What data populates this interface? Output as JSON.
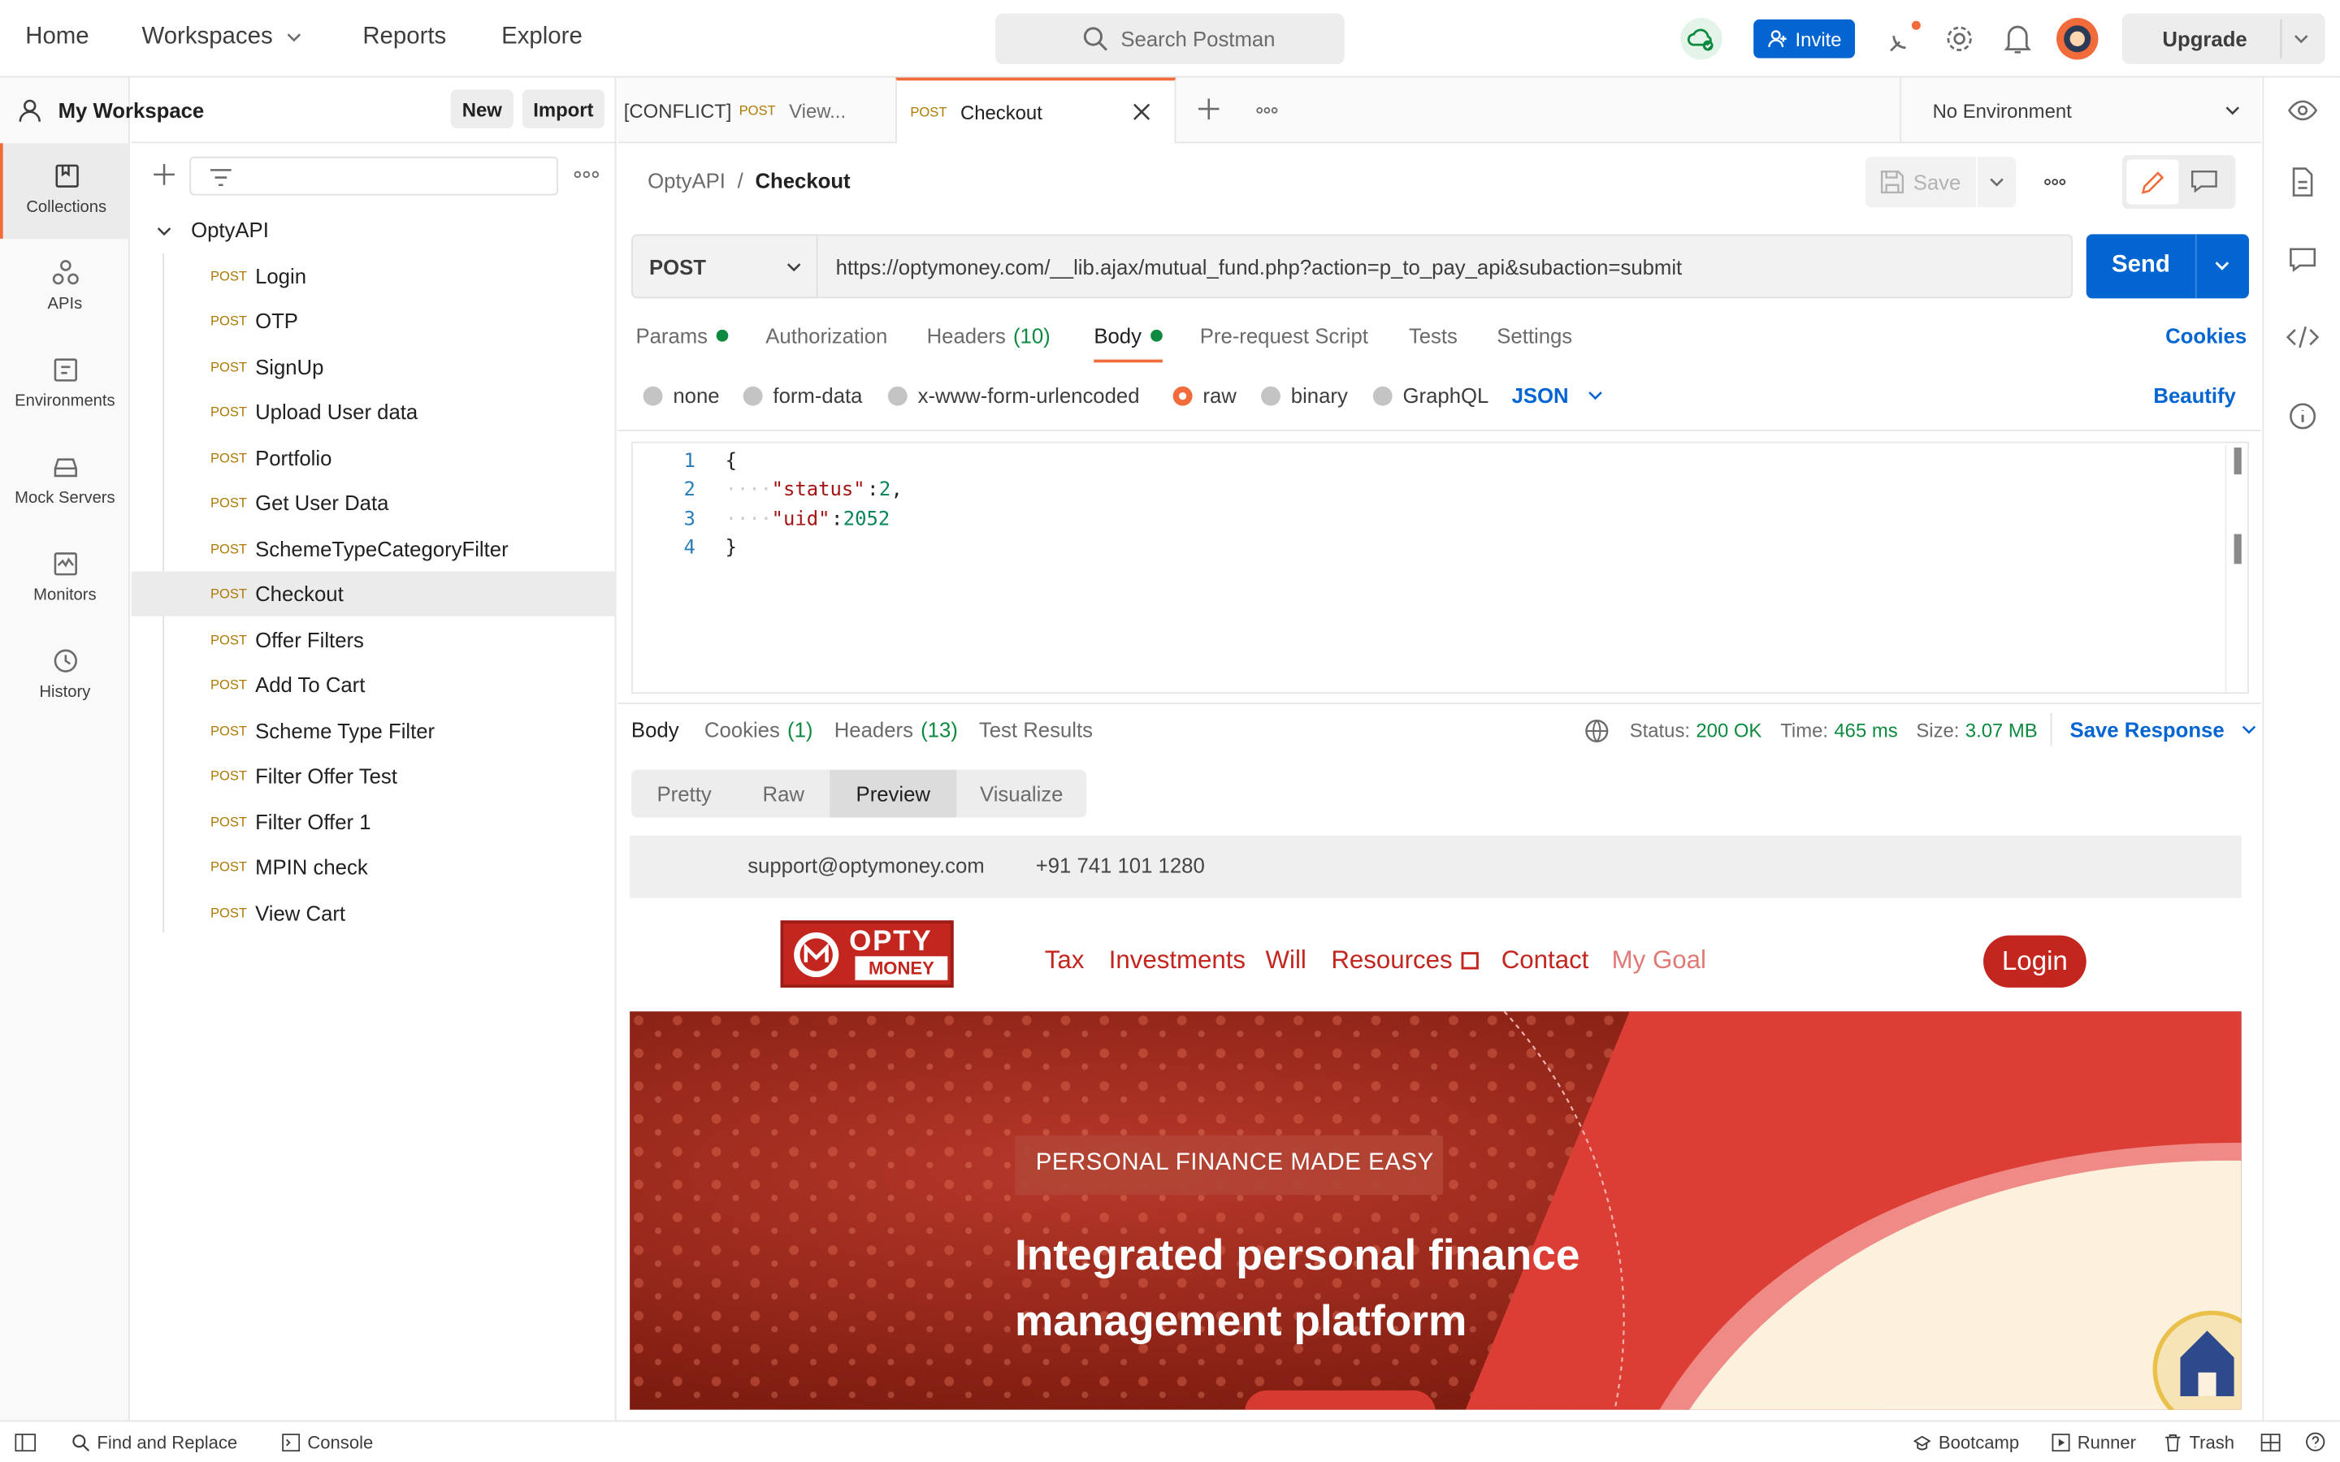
{
  "topbar": {
    "nav": [
      "Home",
      "Workspaces",
      "Reports",
      "Explore"
    ],
    "search_placeholder": "Search Postman",
    "invite_label": "Invite",
    "upgrade_label": "Upgrade"
  },
  "rail": {
    "items": [
      {
        "label": "Collections",
        "icon": "collections-icon"
      },
      {
        "label": "APIs",
        "icon": "apis-icon"
      },
      {
        "label": "Environments",
        "icon": "environments-icon"
      },
      {
        "label": "Mock Servers",
        "icon": "mock-servers-icon"
      },
      {
        "label": "Monitors",
        "icon": "monitors-icon"
      },
      {
        "label": "History",
        "icon": "history-icon"
      }
    ]
  },
  "sidebar": {
    "workspace_name": "My Workspace",
    "new_label": "New",
    "import_label": "Import",
    "collection_name": "OptyAPI",
    "requests": [
      {
        "method": "POST",
        "name": "Login"
      },
      {
        "method": "POST",
        "name": "OTP"
      },
      {
        "method": "POST",
        "name": "SignUp"
      },
      {
        "method": "POST",
        "name": "Upload User data"
      },
      {
        "method": "POST",
        "name": "Portfolio"
      },
      {
        "method": "POST",
        "name": "Get User Data"
      },
      {
        "method": "POST",
        "name": "SchemeTypeCategoryFilter"
      },
      {
        "method": "POST",
        "name": "Checkout"
      },
      {
        "method": "POST",
        "name": "Offer Filters"
      },
      {
        "method": "POST",
        "name": "Add To Cart"
      },
      {
        "method": "POST",
        "name": "Scheme Type Filter"
      },
      {
        "method": "POST",
        "name": "Filter Offer Test"
      },
      {
        "method": "POST",
        "name": "Filter Offer 1"
      },
      {
        "method": "POST",
        "name": "MPIN check"
      },
      {
        "method": "POST",
        "name": "View Cart"
      }
    ]
  },
  "tabs": {
    "tab1": {
      "prefix": "[CONFLICT]",
      "method": "POST",
      "name": "View..."
    },
    "tab2": {
      "method": "POST",
      "name": "Checkout"
    },
    "environment": "No Environment"
  },
  "request": {
    "breadcrumb_parent": "OptyAPI",
    "breadcrumb_sep": "/",
    "breadcrumb_current": "Checkout",
    "save_label": "Save",
    "method": "POST",
    "url": "https://optymoney.com/__lib.ajax/mutual_fund.php?action=p_to_pay_api&subaction=submit",
    "send_label": "Send",
    "tabs": {
      "params": "Params",
      "authorization": "Authorization",
      "headers": "Headers",
      "headers_count": "(10)",
      "body": "Body",
      "prerequest": "Pre-request Script",
      "tests": "Tests",
      "settings": "Settings",
      "cookies": "Cookies"
    },
    "body_types": [
      "none",
      "form-data",
      "x-www-form-urlencoded",
      "raw",
      "binary",
      "GraphQL"
    ],
    "body_format": "JSON",
    "beautify_label": "Beautify",
    "code": {
      "line_numbers": [
        "1",
        "2",
        "3",
        "4"
      ],
      "l1": "{",
      "l2_key": "\"status\"",
      "l2_val": "2",
      "l3_key": "\"uid\"",
      "l3_val": "2052",
      "l4": "}"
    }
  },
  "response": {
    "tabs": {
      "body": "Body",
      "cookies": "Cookies",
      "cookies_count": "(1)",
      "headers": "Headers",
      "headers_count": "(13)",
      "test_results": "Test Results"
    },
    "status_label": "Status:",
    "status_value": "200 OK",
    "time_label": "Time:",
    "time_value": "465 ms",
    "size_label": "Size:",
    "size_value": "3.07 MB",
    "save_response_label": "Save Response",
    "view_tabs": [
      "Pretty",
      "Raw",
      "Preview",
      "Visualize"
    ]
  },
  "preview": {
    "email": "support@optymoney.com",
    "phone": "+91 741 101 1280",
    "logo_top": "OPTY",
    "logo_bottom": "MONEY",
    "nav": [
      "Tax",
      "Investments",
      "Will",
      "Resources",
      "Contact",
      "My Goal"
    ],
    "login_label": "Login",
    "hero_tag": "PERSONAL FINANCE MADE EASY",
    "hero_line1": "Integrated personal finance",
    "hero_line2": "management platform"
  },
  "bottombar": {
    "find_replace": "Find and Replace",
    "console": "Console",
    "bootcamp": "Bootcamp",
    "runner": "Runner",
    "trash": "Trash"
  },
  "colors": {
    "accent": "#f26b3a",
    "primary": "#0265d2",
    "post_method": "#ad7a03",
    "success": "#0d8a3f",
    "brand_red": "#c3261f"
  }
}
